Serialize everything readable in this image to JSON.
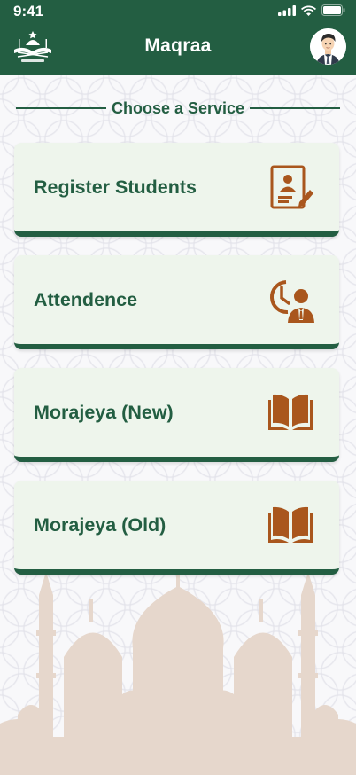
{
  "status_bar": {
    "time": "9:41"
  },
  "header": {
    "title": "Maqraa"
  },
  "section": {
    "title": "Choose a Service"
  },
  "services": [
    {
      "label": "Register Students",
      "icon": "register-document-icon"
    },
    {
      "label": "Attendence",
      "icon": "attendance-clock-person-icon"
    },
    {
      "label": "Morajeya (New)",
      "icon": "open-book-icon"
    },
    {
      "label": "Morajeya (Old)",
      "icon": "open-book-icon"
    }
  ],
  "colors": {
    "primary": "#235e42",
    "card": "#eef5ec",
    "icon": "#a9561d",
    "mosque": "#e6d7cc"
  }
}
